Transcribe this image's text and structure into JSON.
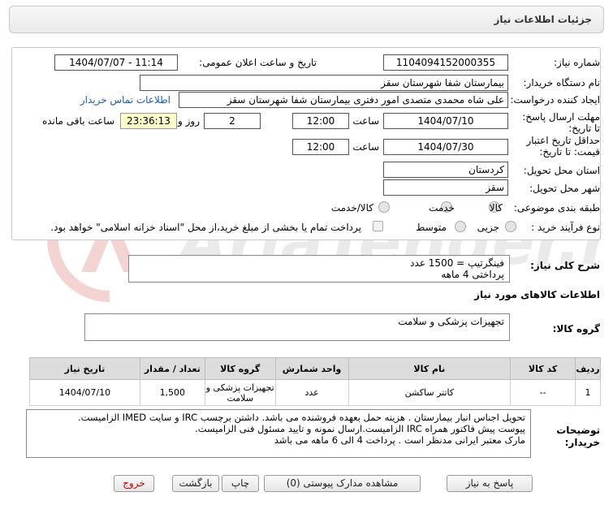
{
  "header": {
    "title": "جزئیات اطلاعات نیاز"
  },
  "form": {
    "need_number_label": "شماره نیاز:",
    "need_number": "1104094152000355",
    "announce_label": "تاریخ و ساعت اعلان عمومی:",
    "announce_value": "1404/07/07 - 11:14",
    "buyer_org_label": "نام دستگاه خریدار:",
    "buyer_org": "بیمارستان شفا شهرستان سقز",
    "requester_label": "ایجاد کننده درخواست:",
    "requester": "علی شاه محمدی متصدی امور دفتری بیمارستان شفا شهرستان سقز",
    "contact_link": "اطلاعات تماس خریدار",
    "reply_deadline_label": "مهلت ارسال پاسخ: تا تاریخ:",
    "reply_date": "1404/07/10",
    "time_label": "ساعت",
    "reply_time": "12:00",
    "days_value": "2",
    "days_label": "روز و",
    "remaining_time": "23:36:13",
    "remaining_label": "ساعت باقی مانده",
    "validity_label": "حداقل تاریخ اعتبار قیمت: تا تاریخ:",
    "validity_date": "1404/07/30",
    "validity_time": "12:00",
    "province_label": "استان محل تحویل:",
    "province": "کردستان",
    "city_label": "شهر محل تحویل:",
    "city": "سقز",
    "category_label": "طبقه بندی موضوعی:",
    "category_options": [
      "کالا",
      "خدمت",
      "کالا/خدمت"
    ],
    "process_label": "نوع فرآیند خرید :",
    "process_options": [
      "جزیی",
      "متوسط"
    ],
    "payment_note": "پرداخت تمام یا بخشی از مبلغ خرید،از محل \"اسناد خزانه اسلامی\" خواهد بود."
  },
  "general_desc": {
    "label": "شرح کلی نیاز:",
    "text": "فینگرتیپ = 1500 عدد\nپرداختی 4 ماهه"
  },
  "goods": {
    "section_title": "اطلاعات کالاهای مورد نیاز",
    "group_label": "گروه کالا:",
    "group_value": "تجهیزات پزشکی و سلامت",
    "columns": [
      "ردیف",
      "کد کالا",
      "نام کالا",
      "واحد شمارش",
      "گروه کالا",
      "تعداد / مقدار",
      "تاریخ نیاز"
    ],
    "rows": [
      [
        "1",
        "--",
        "کاتتر ساکشن",
        "عدد",
        "تجهیزات پزشکی و سلامت",
        "1,500",
        "1404/07/10"
      ]
    ]
  },
  "buyer_notes": {
    "label": "توضیحات خریدار:",
    "text": "تحویل اجناس  انبار بیمارستان . هزینه حمل بعهده فروشنده می باشد.  داشتن برچسب IRC  و سایت  IMED  الزامیست.\nپیوست پیش فاکتور همراه IRC  الزامیست.ارسال نمونه و تایید مسئول فنی الزامیست.\n مارک معتبر ایرانی مدنظر است . پرداخت 4 الی 6 ماهه می باشد"
  },
  "buttons": {
    "reply": "پاسخ به نیاز",
    "attachments": "مشاهده مدارک پیوستی (0)",
    "print": "چاپ",
    "back": "بازگشت",
    "exit": "خروج"
  },
  "watermark": {
    "brand": "AriaTender.net"
  },
  "colors": {
    "link": "#1a5ab4",
    "timer_bg": "#ffffcc",
    "header_bg": "#dcdcdc",
    "exit_text": "#c00000"
  }
}
